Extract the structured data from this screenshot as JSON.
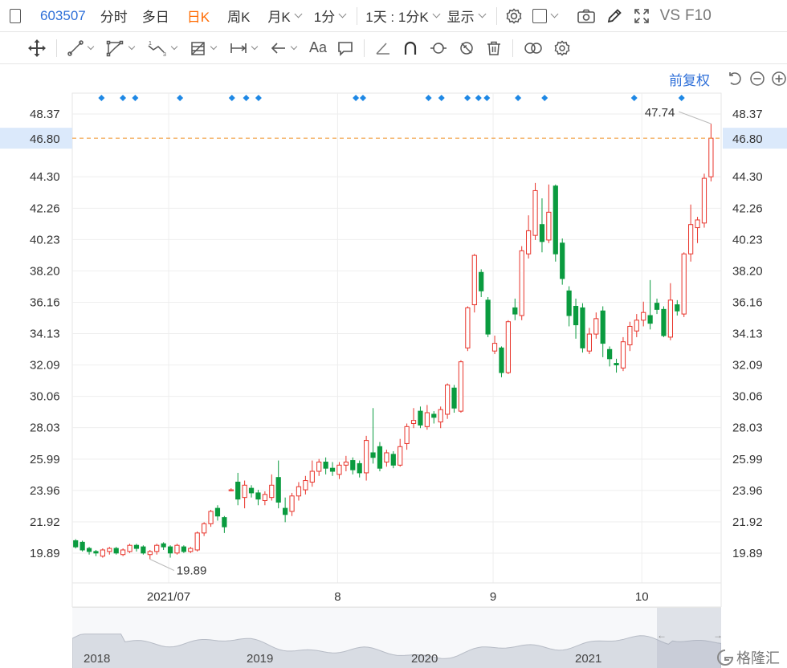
{
  "toolbar": {
    "code": "603507",
    "intraday": "分时",
    "multi_day": "多日",
    "daily_k": "日K",
    "weekly_k": "周K",
    "monthly_k": "月K",
    "minute": "1分",
    "range": "1天 : 1分K",
    "display": "显示",
    "vs": "VS",
    "f10": "F10"
  },
  "toolbar2": {
    "text_tool": "Aa"
  },
  "adjust_label": "前复权",
  "watermark": "格隆汇",
  "colors": {
    "up": "#e8332a",
    "down": "#0a9b3f",
    "marker": "#1e88e5",
    "price_line": "#f0932b",
    "price_tag_bg": "#dbe9fb",
    "price_tag_text": "#e8332a",
    "active": "#ff6a00",
    "link": "#2e6fd8"
  },
  "chart_data": {
    "type": "candlestick",
    "y_ticks": [
      "48.37",
      "44.30",
      "42.26",
      "40.23",
      "38.20",
      "36.16",
      "34.13",
      "32.09",
      "30.06",
      "28.03",
      "25.99",
      "23.96",
      "21.92",
      "19.89"
    ],
    "current_price": "46.80",
    "high_label": "47.74",
    "low_label": "19.89",
    "x_labels": [
      "2021/07",
      "8",
      "9",
      "10"
    ],
    "navigator_years": [
      "2018",
      "2019",
      "2020",
      "2021"
    ],
    "candles": [
      [
        20.7,
        20.3,
        20.8,
        20.2
      ],
      [
        20.6,
        20.1,
        20.7,
        20.0
      ],
      [
        20.2,
        20.0,
        20.3,
        19.8
      ],
      [
        20.0,
        19.9,
        20.1,
        19.7
      ],
      [
        19.7,
        20.1,
        20.2,
        19.6
      ],
      [
        20.0,
        20.2,
        20.3,
        19.8
      ],
      [
        20.2,
        19.9,
        20.3,
        19.8
      ],
      [
        19.8,
        20.1,
        20.2,
        19.7
      ],
      [
        20.0,
        20.4,
        20.5,
        19.9
      ],
      [
        20.4,
        20.2,
        20.5,
        20.0
      ],
      [
        20.3,
        19.9,
        20.4,
        19.8
      ],
      [
        19.8,
        20.0,
        20.1,
        19.5
      ],
      [
        20.0,
        20.4,
        20.5,
        19.8
      ],
      [
        20.5,
        20.3,
        20.6,
        20.1
      ],
      [
        20.3,
        19.9,
        20.4,
        19.6
      ],
      [
        19.9,
        20.4,
        20.5,
        19.8
      ],
      [
        20.3,
        20.0,
        20.4,
        19.9
      ],
      [
        20.0,
        20.2,
        20.3,
        19.9
      ],
      [
        20.1,
        21.2,
        21.3,
        20.0
      ],
      [
        21.2,
        21.8,
        21.9,
        21.0
      ],
      [
        21.8,
        22.6,
        22.7,
        21.6
      ],
      [
        22.8,
        22.3,
        23.0,
        22.0
      ],
      [
        22.2,
        21.6,
        22.3,
        21.2
      ],
      [
        24.0,
        24.0,
        24.1,
        23.9
      ],
      [
        24.5,
        23.4,
        25.1,
        23.0
      ],
      [
        23.5,
        24.3,
        24.6,
        22.8
      ],
      [
        24.1,
        23.8,
        24.3,
        23.5
      ],
      [
        23.8,
        23.4,
        24.0,
        23.0
      ],
      [
        23.3,
        23.7,
        23.9,
        23.0
      ],
      [
        23.5,
        24.3,
        25.0,
        23.3
      ],
      [
        24.8,
        23.2,
        25.9,
        22.8
      ],
      [
        22.8,
        22.4,
        23.5,
        21.9
      ],
      [
        22.6,
        23.6,
        23.8,
        22.3
      ],
      [
        23.6,
        24.2,
        24.5,
        23.3
      ],
      [
        24.0,
        24.6,
        24.9,
        23.7
      ],
      [
        24.5,
        25.2,
        25.9,
        24.2
      ],
      [
        25.2,
        25.8,
        26.0,
        24.9
      ],
      [
        25.8,
        25.4,
        26.1,
        25.0
      ],
      [
        25.4,
        25.2,
        25.8,
        24.9
      ],
      [
        25.0,
        25.6,
        25.8,
        24.7
      ],
      [
        25.6,
        25.8,
        26.2,
        25.2
      ],
      [
        25.9,
        25.3,
        26.1,
        25.0
      ],
      [
        25.7,
        25.1,
        25.9,
        24.8
      ],
      [
        25.1,
        27.2,
        27.5,
        24.6
      ],
      [
        26.4,
        26.1,
        29.3,
        25.7
      ],
      [
        26.8,
        25.4,
        27.1,
        25.2
      ],
      [
        25.8,
        26.4,
        26.6,
        25.5
      ],
      [
        26.3,
        25.6,
        26.5,
        25.4
      ],
      [
        25.6,
        26.8,
        27.3,
        25.5
      ],
      [
        27.0,
        28.1,
        28.3,
        26.6
      ],
      [
        28.3,
        28.5,
        29.3,
        28.0
      ],
      [
        29.1,
        28.2,
        29.4,
        28.0
      ],
      [
        28.1,
        29.0,
        29.5,
        27.9
      ],
      [
        28.9,
        28.7,
        29.1,
        28.3
      ],
      [
        28.4,
        29.2,
        29.4,
        28.0
      ],
      [
        28.9,
        30.8,
        30.9,
        28.6
      ],
      [
        30.6,
        29.3,
        30.8,
        29.0
      ],
      [
        29.1,
        32.3,
        32.4,
        29.0
      ],
      [
        33.2,
        35.8,
        35.9,
        33.0
      ],
      [
        36.0,
        39.2,
        39.3,
        35.5
      ],
      [
        38.1,
        36.9,
        38.3,
        36.5
      ],
      [
        36.3,
        34.1,
        36.5,
        33.9
      ],
      [
        33.0,
        33.5,
        34.0,
        32.8
      ],
      [
        33.2,
        31.6,
        33.3,
        31.3
      ],
      [
        31.6,
        34.9,
        35.0,
        31.5
      ],
      [
        35.8,
        35.4,
        36.4,
        35.0
      ],
      [
        35.3,
        39.5,
        39.8,
        35.0
      ],
      [
        39.3,
        40.8,
        41.8,
        39.0
      ],
      [
        40.5,
        43.4,
        43.9,
        40.2
      ],
      [
        41.2,
        40.1,
        42.9,
        39.4
      ],
      [
        40.2,
        42.0,
        43.8,
        40.0
      ],
      [
        43.7,
        39.3,
        43.8,
        38.8
      ],
      [
        40.0,
        37.7,
        40.3,
        37.3
      ],
      [
        36.9,
        35.3,
        37.2,
        34.6
      ],
      [
        35.9,
        34.7,
        36.4,
        33.8
      ],
      [
        35.8,
        33.2,
        36.1,
        32.9
      ],
      [
        33.0,
        34.1,
        34.5,
        32.8
      ],
      [
        34.1,
        35.1,
        35.5,
        33.8
      ],
      [
        35.6,
        33.5,
        35.9,
        32.6
      ],
      [
        33.1,
        32.5,
        33.3,
        32.0
      ],
      [
        32.2,
        32.1,
        32.5,
        31.6
      ],
      [
        31.9,
        33.6,
        33.9,
        31.7
      ],
      [
        33.4,
        34.6,
        34.9,
        33.0
      ],
      [
        34.3,
        35.0,
        35.4,
        33.9
      ],
      [
        35.0,
        35.5,
        36.2,
        34.6
      ],
      [
        35.3,
        34.8,
        37.6,
        34.4
      ],
      [
        36.1,
        35.7,
        36.4,
        35.4
      ],
      [
        35.7,
        34.0,
        35.9,
        33.9
      ],
      [
        33.9,
        36.3,
        37.4,
        33.7
      ],
      [
        36.0,
        35.6,
        36.3,
        35.3
      ],
      [
        35.4,
        39.3,
        39.4,
        35.2
      ],
      [
        39.3,
        41.2,
        42.5,
        38.8
      ],
      [
        41.0,
        41.5,
        41.7,
        40.0
      ],
      [
        41.3,
        44.2,
        44.5,
        41.0
      ],
      [
        44.3,
        46.8,
        47.74,
        44.0
      ]
    ],
    "markers": [
      0.045,
      0.078,
      0.097,
      0.166,
      0.246,
      0.268,
      0.287,
      0.437,
      0.448,
      0.549,
      0.569,
      0.609,
      0.626,
      0.639,
      0.687,
      0.728,
      0.866,
      0.939
    ]
  }
}
